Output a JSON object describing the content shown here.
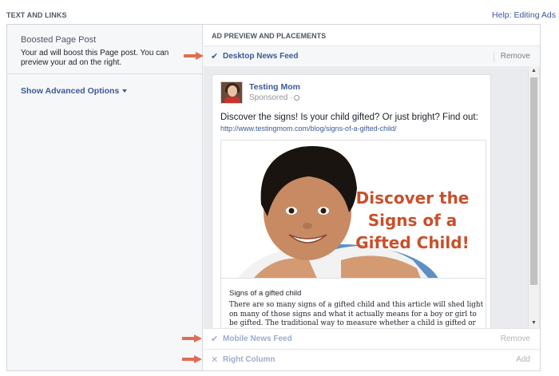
{
  "header": {
    "section_title": "TEXT AND LINKS",
    "help_link": "Help: Editing Ads"
  },
  "left": {
    "boosted_heading": "Boosted Page Post",
    "boosted_desc": "Your ad will boost this Page post. You can preview your ad on the right.",
    "advanced_options": "Show Advanced Options"
  },
  "preview": {
    "title": "AD PREVIEW AND PLACEMENTS",
    "placements": {
      "desktop": {
        "icon": "✔",
        "label": "Desktop News Feed",
        "action": "Remove"
      },
      "mobile": {
        "icon": "✔",
        "label": "Mobile News Feed",
        "action": "Remove"
      },
      "right": {
        "icon": "✕",
        "label": "Right Column",
        "action": "Add"
      }
    },
    "post": {
      "page_name": "Testing Mom",
      "sponsored": "Sponsored ·",
      "text": "Discover the signs! Is your child gifted? Or just bright? Find out:",
      "link": "http://www.testingmom.com/blog/signs-of-a-gifted-child/",
      "image_headline": "Discover the Signs of a Gifted Child!",
      "caption": "Signs of a gifted child",
      "body": "There are so many signs of a gifted child and this article will shed light on many of those signs and what it actually means for a boy or girl to be gifted. The traditional way to measure whether a child is gifted or not is from an IQ test. Here's the..."
    }
  },
  "colors": {
    "link_blue": "#3b5998",
    "annotation_arrow": "#e06c52",
    "headline_orange": "#c8502a"
  },
  "icons": {
    "check": "check-icon",
    "cross": "x-icon",
    "caret": "caret-down-icon",
    "globe": "globe-icon"
  }
}
